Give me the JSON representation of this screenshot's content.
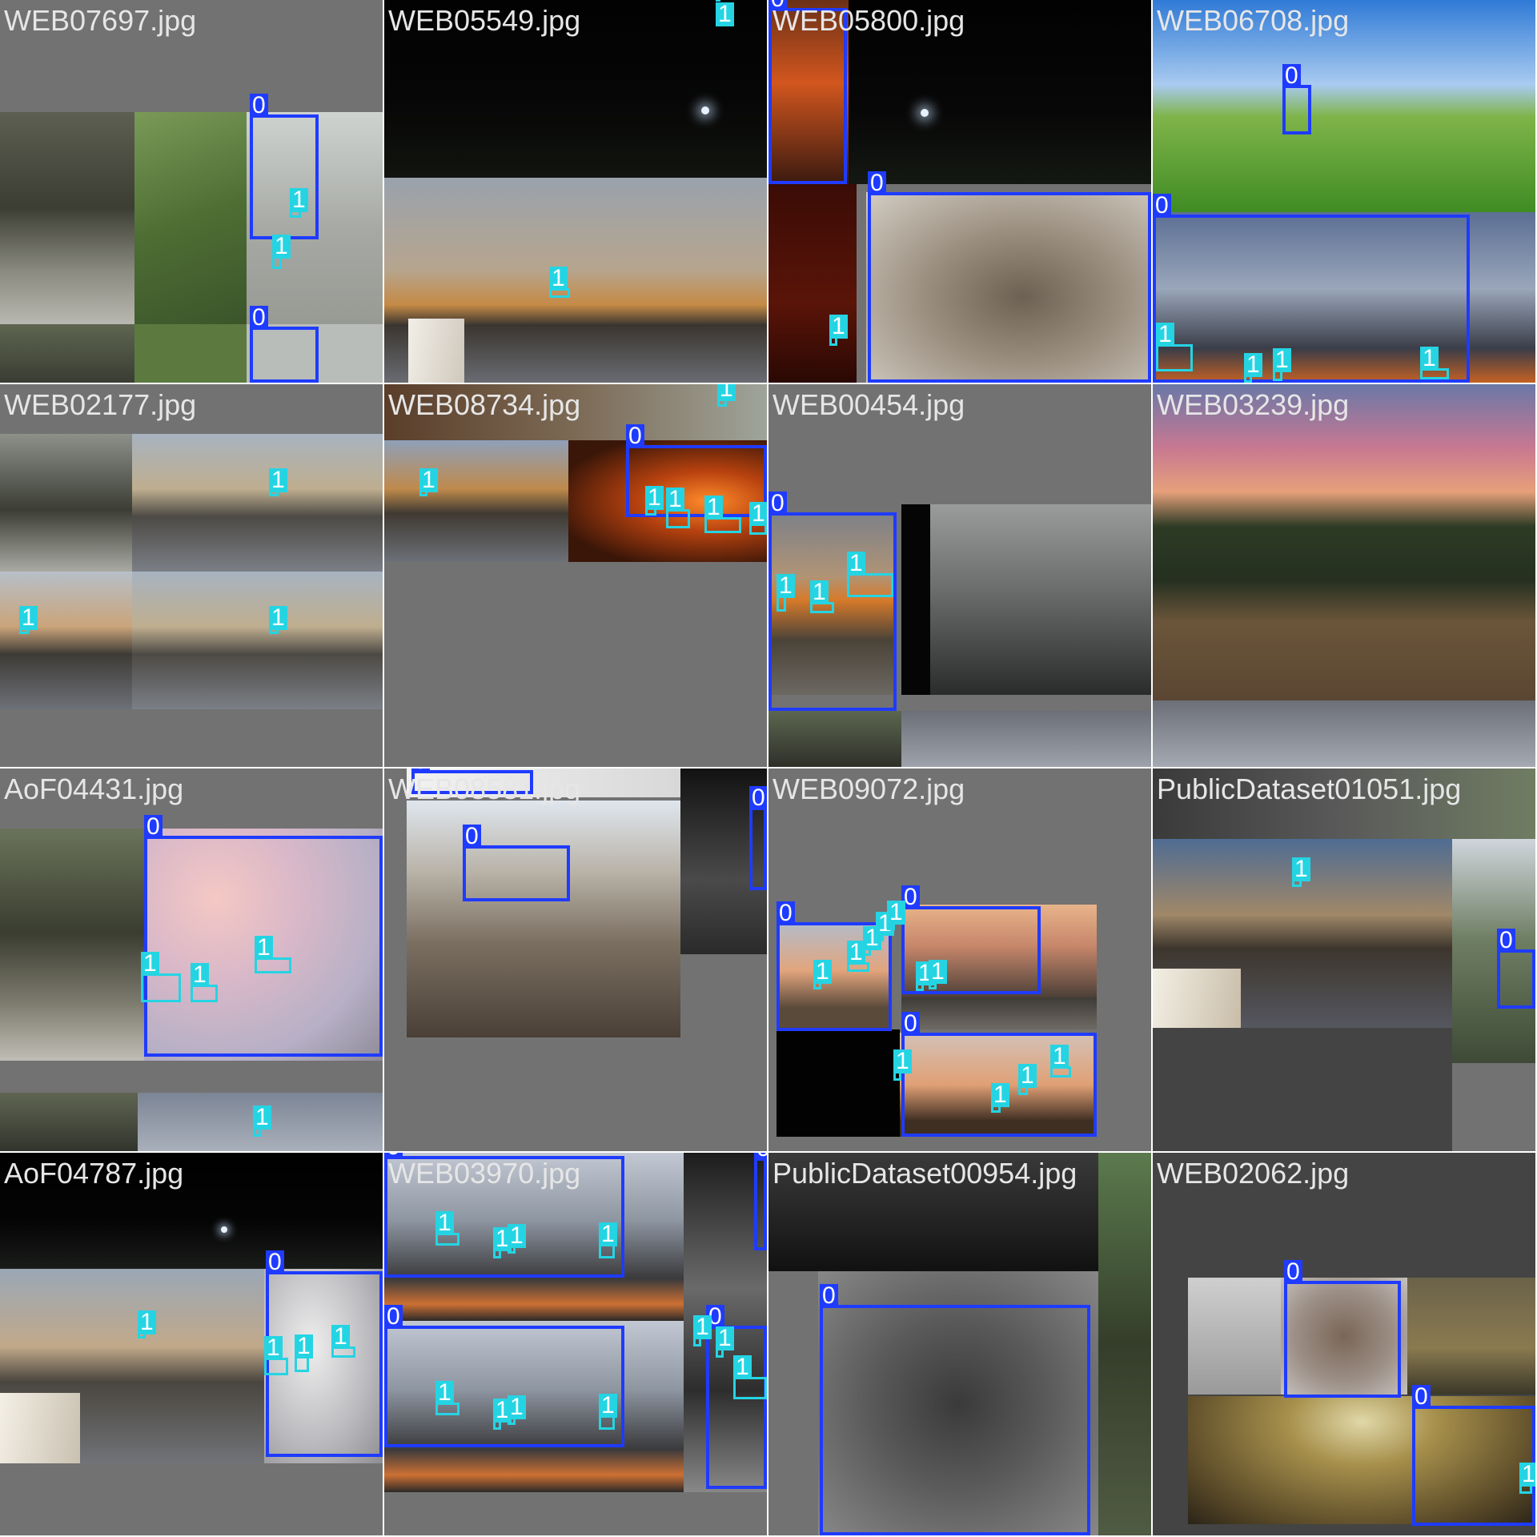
{
  "figure": {
    "kind": "mosaic of detection samples",
    "columns": 4,
    "rows": 4
  },
  "colors": {
    "class_0_box": "#1f3bff",
    "class_1_box": "#25d4e3",
    "pad_gray": "#727272",
    "filename_text": "#e6e6e6"
  },
  "class_labels": {
    "smoke": "0",
    "fire": "1"
  },
  "tiles": [
    {
      "filename": "WEB07697.jpg",
      "labels": [
        "0",
        "1",
        "1",
        "0"
      ]
    },
    {
      "filename": "WEB05549.jpg",
      "labels": [
        "1",
        "1"
      ]
    },
    {
      "filename": "WEB05800.jpg",
      "labels": [
        "0",
        "0",
        "1"
      ]
    },
    {
      "filename": "WEB06708.jpg",
      "labels": [
        "0",
        "0",
        "1",
        "1",
        "1",
        "1"
      ]
    },
    {
      "filename": "WEB02177.jpg",
      "labels": [
        "1",
        "1",
        "1"
      ]
    },
    {
      "filename": "WEB08734.jpg",
      "labels": [
        "0",
        "1",
        "1",
        "1",
        "1",
        "1",
        "1"
      ]
    },
    {
      "filename": "WEB00454.jpg",
      "labels": [
        "0",
        "1",
        "1",
        "1"
      ]
    },
    {
      "filename": "WEB03239.jpg",
      "labels": []
    },
    {
      "filename": "AoF04431.jpg",
      "labels": [
        "0",
        "1",
        "1",
        "1",
        "1"
      ]
    },
    {
      "filename": "WEB08581.jpg",
      "labels": [
        "0",
        "0",
        "0"
      ]
    },
    {
      "filename": "WEB09072.jpg",
      "labels": [
        "0",
        "0",
        "0",
        "1",
        "1",
        "1",
        "1",
        "1",
        "1",
        "1",
        "1",
        "1",
        "1",
        "1"
      ]
    },
    {
      "filename": "PublicDataset01051.jpg",
      "labels": [
        "1",
        "0"
      ]
    },
    {
      "filename": "AoF04787.jpg",
      "labels": [
        "0",
        "1",
        "1",
        "1",
        "1"
      ]
    },
    {
      "filename": "WEB03970.jpg",
      "labels": [
        "0",
        "0",
        "0",
        "0",
        "1",
        "1",
        "1",
        "1",
        "1",
        "1",
        "1",
        "1",
        "1",
        "1",
        "1"
      ]
    },
    {
      "filename": "PublicDataset00954.jpg",
      "labels": [
        "0"
      ]
    },
    {
      "filename": "WEB02062.jpg",
      "labels": [
        "0",
        "0",
        "1"
      ]
    }
  ]
}
